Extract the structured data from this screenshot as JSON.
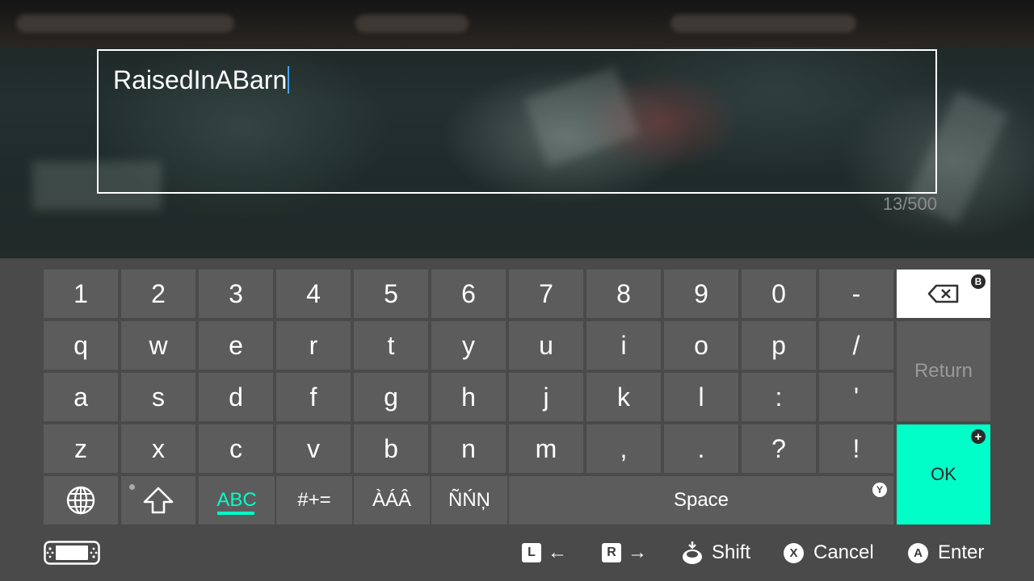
{
  "input": {
    "text": "RaisedInABarn",
    "char_count": "13/500"
  },
  "keyboard": {
    "row_numbers": [
      "1",
      "2",
      "3",
      "4",
      "5",
      "6",
      "7",
      "8",
      "9",
      "0",
      "-"
    ],
    "row_top": [
      "q",
      "w",
      "e",
      "r",
      "t",
      "y",
      "u",
      "i",
      "o",
      "p",
      "/"
    ],
    "row_mid": [
      "a",
      "s",
      "d",
      "f",
      "g",
      "h",
      "j",
      "k",
      "l",
      ":",
      "'"
    ],
    "row_bottom": [
      "z",
      "x",
      "c",
      "v",
      "b",
      "n",
      "m",
      ",",
      ".",
      "?",
      "!"
    ],
    "modes": [
      "ABC",
      "#+=",
      "ÀÁÂ",
      "ÑŃŅ"
    ],
    "active_mode": "ABC",
    "space_label": "Space",
    "space_badge": "Y",
    "return_label": "Return",
    "ok_label": "OK",
    "ok_badge": "+",
    "backspace_badge": "B",
    "accent_color": "#00ffc8",
    "key_color": "#5c5c5c",
    "panel_color": "#4a4a4a"
  },
  "hints": {
    "left_button": "L",
    "left_arrow": "←",
    "right_button": "R",
    "right_arrow": "→",
    "shift_label": "Shift",
    "cancel_button": "X",
    "cancel_label": "Cancel",
    "enter_button": "A",
    "enter_label": "Enter"
  },
  "icons": {
    "globe": "globe-icon",
    "shift": "shift-arrow-icon",
    "backspace": "backspace-icon",
    "handheld": "handheld-console-icon",
    "stick": "stick-press-icon"
  }
}
